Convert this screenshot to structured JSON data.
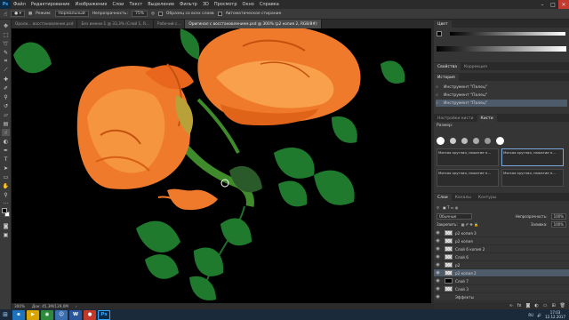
{
  "app": {
    "logo": "Ps"
  },
  "menu": [
    "Файл",
    "Редактирование",
    "Изображение",
    "Слои",
    "Текст",
    "Выделение",
    "Фильтр",
    "3D",
    "Просмотр",
    "Окно",
    "Справка"
  ],
  "options_bar": {
    "mode_label": "Режим:",
    "mode_value": "Нормальный",
    "opacity_label": "Непрозрачность:",
    "opacity_value": "75%",
    "sample_all_label": "Образец со всех слоев",
    "auto_erase_label": "Автоматическое стирание"
  },
  "doc_tabs": [
    {
      "label": "Ороли... восстановление.psd",
      "active": false
    },
    {
      "label": "Без имени-1 @ 33,3% (Слой 1, R...",
      "active": false
    },
    {
      "label": "Рабочий с...",
      "active": false
    },
    {
      "label": "Оригинал с восстановлением.psd @ 300% (p2 копия 2, RGB/8#)",
      "active": true
    }
  ],
  "status_bar": {
    "zoom": "300%",
    "doc_size": "Док: 45,3M/129,0M"
  },
  "panels": {
    "swatches_tab": "Цвет",
    "properties_tabs": [
      "Свойства",
      "Коррекция"
    ],
    "history_tab": "История",
    "history_items": [
      "Инструмент \"Палец\"",
      "Инструмент \"Палец\"",
      "Инструмент \"Палец\""
    ],
    "brushes_tabs": [
      "Настройки кисти",
      "Кисти"
    ],
    "brush_size_label": "Размер:",
    "brush_names": [
      "Мягкая круглая, нажатие п...",
      "Мягкая круглая, нажатие п...",
      "Мягкая круглая, нажатие п...",
      "Мягкая круглая, нажатие п..."
    ],
    "layers_tabs": [
      "Слои",
      "Каналы",
      "Контуры"
    ],
    "blend_mode": "Обычные",
    "opacity_label": "Непрозрачность:",
    "opacity_value": "100%",
    "lock_label": "Закрепить:",
    "fill_label": "Заливка:",
    "fill_value": "100%",
    "layers": [
      {
        "name": "p2 копия 3",
        "selected": false,
        "thumb": "transparent"
      },
      {
        "name": "p2 копия",
        "selected": false,
        "thumb": "transparent"
      },
      {
        "name": "Слой 6 копия 2",
        "selected": false,
        "thumb": "transparent"
      },
      {
        "name": "Слой 6",
        "selected": false,
        "thumb": "transparent"
      },
      {
        "name": "p2",
        "selected": false,
        "thumb": "transparent"
      },
      {
        "name": "p2 копия 2",
        "selected": true,
        "thumb": "transparent"
      },
      {
        "name": "Слой 7",
        "selected": false,
        "thumb": "black"
      },
      {
        "name": "Слой 3",
        "selected": false,
        "thumb": "transparent"
      },
      {
        "name": "Эффекты",
        "selected": false,
        "thumb": "none"
      }
    ]
  },
  "taskbar": {
    "apps": [
      {
        "label": "e",
        "color": "#1e73be"
      },
      {
        "label": "▶",
        "color": "#d9a300"
      },
      {
        "label": "◉",
        "color": "#2c8a3a"
      },
      {
        "label": "☺",
        "color": "#3a6fb0"
      },
      {
        "label": "W",
        "color": "#2b579a"
      },
      {
        "label": "●",
        "color": "#c0392b"
      },
      {
        "label": "Ps",
        "color": "#0a2a45"
      }
    ],
    "time": "17:03",
    "date": "12.12.2017",
    "lang": "RU"
  },
  "colors": {
    "rose": "#f07a2c",
    "leaf": "#1f7a2e",
    "accent": "#31a8ff"
  }
}
